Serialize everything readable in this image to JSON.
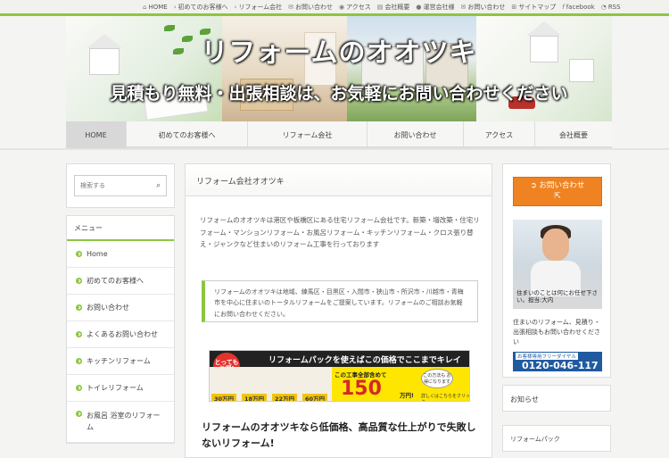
{
  "topnav": [
    {
      "label": "HOME",
      "icon": "home-icon"
    },
    {
      "label": "初めてのお客様へ",
      "icon": "chevron-right-icon"
    },
    {
      "label": "リフォーム会社",
      "icon": "chevron-right-icon"
    },
    {
      "label": "お問い合わせ",
      "icon": "mail-icon"
    },
    {
      "label": "アクセス",
      "icon": "pin-icon"
    },
    {
      "label": "会社概要",
      "icon": "document-icon"
    },
    {
      "label": "運営会社様",
      "icon": "user-icon"
    },
    {
      "label": "お問い合わせ",
      "icon": "mail-icon"
    },
    {
      "label": "サイトマップ",
      "icon": "sitemap-icon"
    },
    {
      "label": "facebook",
      "icon": "facebook-icon"
    },
    {
      "label": "RSS",
      "icon": "rss-icon"
    }
  ],
  "header": {
    "title": "リフォームのオオツキ",
    "subtitle": "見積もり無料・出張相談は、お気軽にお問い合わせください"
  },
  "gnav": [
    "HOME",
    "初めてのお客様へ",
    "リフォーム会社",
    "お問い合わせ",
    "アクセス",
    "会社概要"
  ],
  "search": {
    "placeholder": "検索する"
  },
  "menu": {
    "title": "メニュー",
    "items": [
      "Home",
      "初めてのお客様へ",
      "お問い合わせ",
      "よくあるお問い合わせ",
      "キッチンリフォーム",
      "トイレリフォーム",
      "お風呂 浴室のリフォーム"
    ]
  },
  "main": {
    "heading": "リフォーム会社オオツキ",
    "intro": "リフォームのオオツキは港区や板橋区にある住宅リフォーム会社です。新築・増改築・住宅リフォーム・マンションリフォーム・お風呂リフォーム・キッチンリフォーム・クロス張り替え・ジャンクなど住まいのリフォーム工事を行っております",
    "quote": "リフォームのオオツキは地域、練馬区・目黒区・入間市・狭山市・所沢市・川越市・青梅市を中心に住まいのトータルリフォームをご提案しています。リフォームのご相談お気軽にお問い合わせください。",
    "banner": {
      "pill": "とっても お得!",
      "title": "リフォームパックを使えばこの価格でここまでキレイに!",
      "prices": [
        "30万円",
        "18万円",
        "22万円",
        "60万円"
      ],
      "y1": "この工事全部含めて",
      "big": "150",
      "unit": "万円!",
      "circle": "この方法も お得になります",
      "click": "詳しくはこちらをクリック"
    },
    "lead": "リフォームのオオツキなら低価格、高品質な仕上がりで失敗しないリフォーム!"
  },
  "right": {
    "contact_label": "お問い合わせ",
    "staff_caption": "住まいのことは何にお任せ下さい。担当:大内",
    "text": "住まいのリフォーム、見積り・出張相談もお問い合わせください",
    "freedial_label": "お客様専用フリーダイヤル",
    "phone": "0120-046-117",
    "news": "お知らせ",
    "box2": "リフォームパック"
  },
  "colors": {
    "accent": "#8cc63f",
    "cta": "#f08321",
    "dial": "#1f5aa0"
  }
}
